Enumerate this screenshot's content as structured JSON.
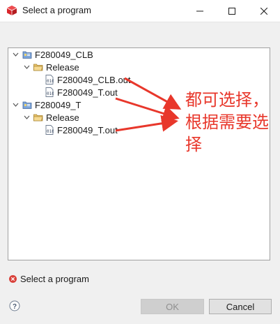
{
  "window": {
    "title": "Select a program",
    "icon": "red-cube-icon",
    "buttons": [
      "minimize-icon",
      "maximize-icon",
      "close-icon"
    ]
  },
  "tree": [
    {
      "label": "F280049_CLB",
      "icon": "project-icon",
      "expanded": true,
      "children": [
        {
          "label": "Release",
          "icon": "folder-icon",
          "expanded": true,
          "children": [
            {
              "label": "F280049_CLB.out",
              "icon": "binary-file-icon"
            },
            {
              "label": "F280049_T.out",
              "icon": "binary-file-icon"
            }
          ]
        }
      ]
    },
    {
      "label": "F280049_T",
      "icon": "project-icon",
      "expanded": true,
      "children": [
        {
          "label": "Release",
          "icon": "folder-icon",
          "expanded": true,
          "children": [
            {
              "label": "F280049_T.out",
              "icon": "binary-file-icon"
            }
          ]
        }
      ]
    }
  ],
  "status": {
    "message": "Select a program",
    "icon": "error-icon"
  },
  "footer": {
    "help_icon": "help-icon",
    "ok_label": "OK",
    "ok_enabled": false,
    "cancel_label": "Cancel"
  },
  "annotation": {
    "text": "都可选择，根据需要选择",
    "color": "#e8372b"
  }
}
